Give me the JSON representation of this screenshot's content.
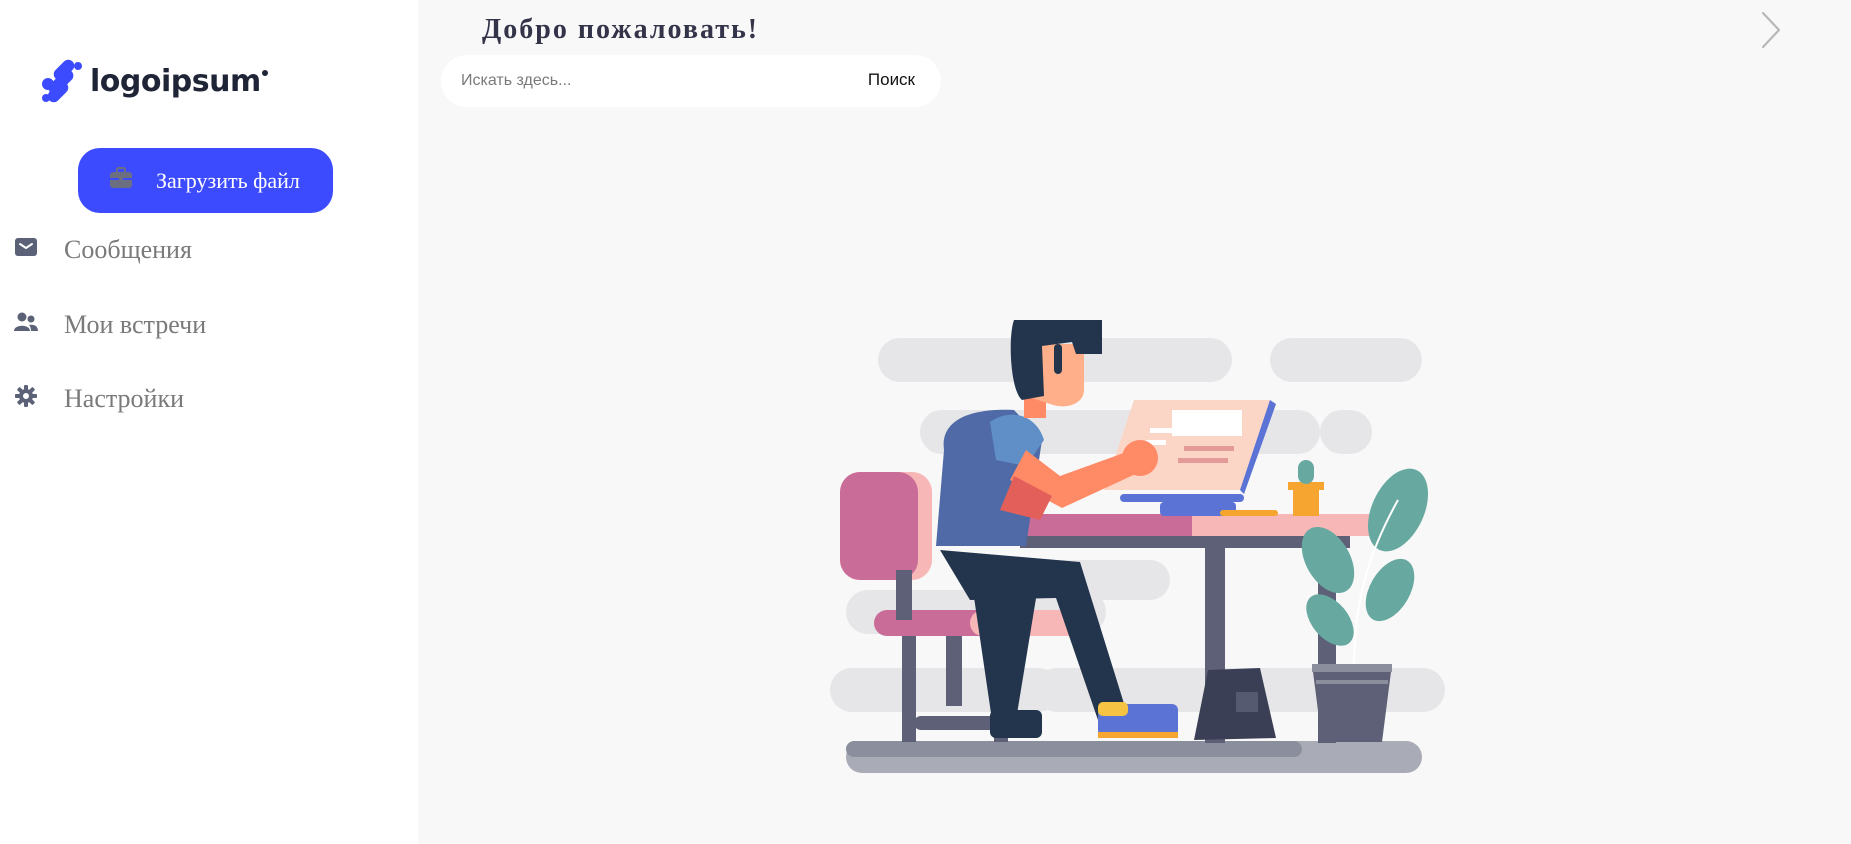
{
  "brand": {
    "logo_text": "logoipsum",
    "logo_icon": "logo-mark",
    "accent": "#3d4bff"
  },
  "sidebar": {
    "upload_button": {
      "label": "Загрузить файл",
      "icon": "briefcase-icon"
    },
    "items": [
      {
        "label": "Сообщения",
        "icon": "envelope-icon"
      },
      {
        "label": "Мои встречи",
        "icon": "users-icon"
      },
      {
        "label": "Настройки",
        "icon": "gear-icon"
      }
    ]
  },
  "header": {
    "welcome": "Добро пожаловать!",
    "search": {
      "placeholder": "Искать здесь...",
      "button_label": "Поиск"
    },
    "next_icon": "chevron-right-icon"
  }
}
